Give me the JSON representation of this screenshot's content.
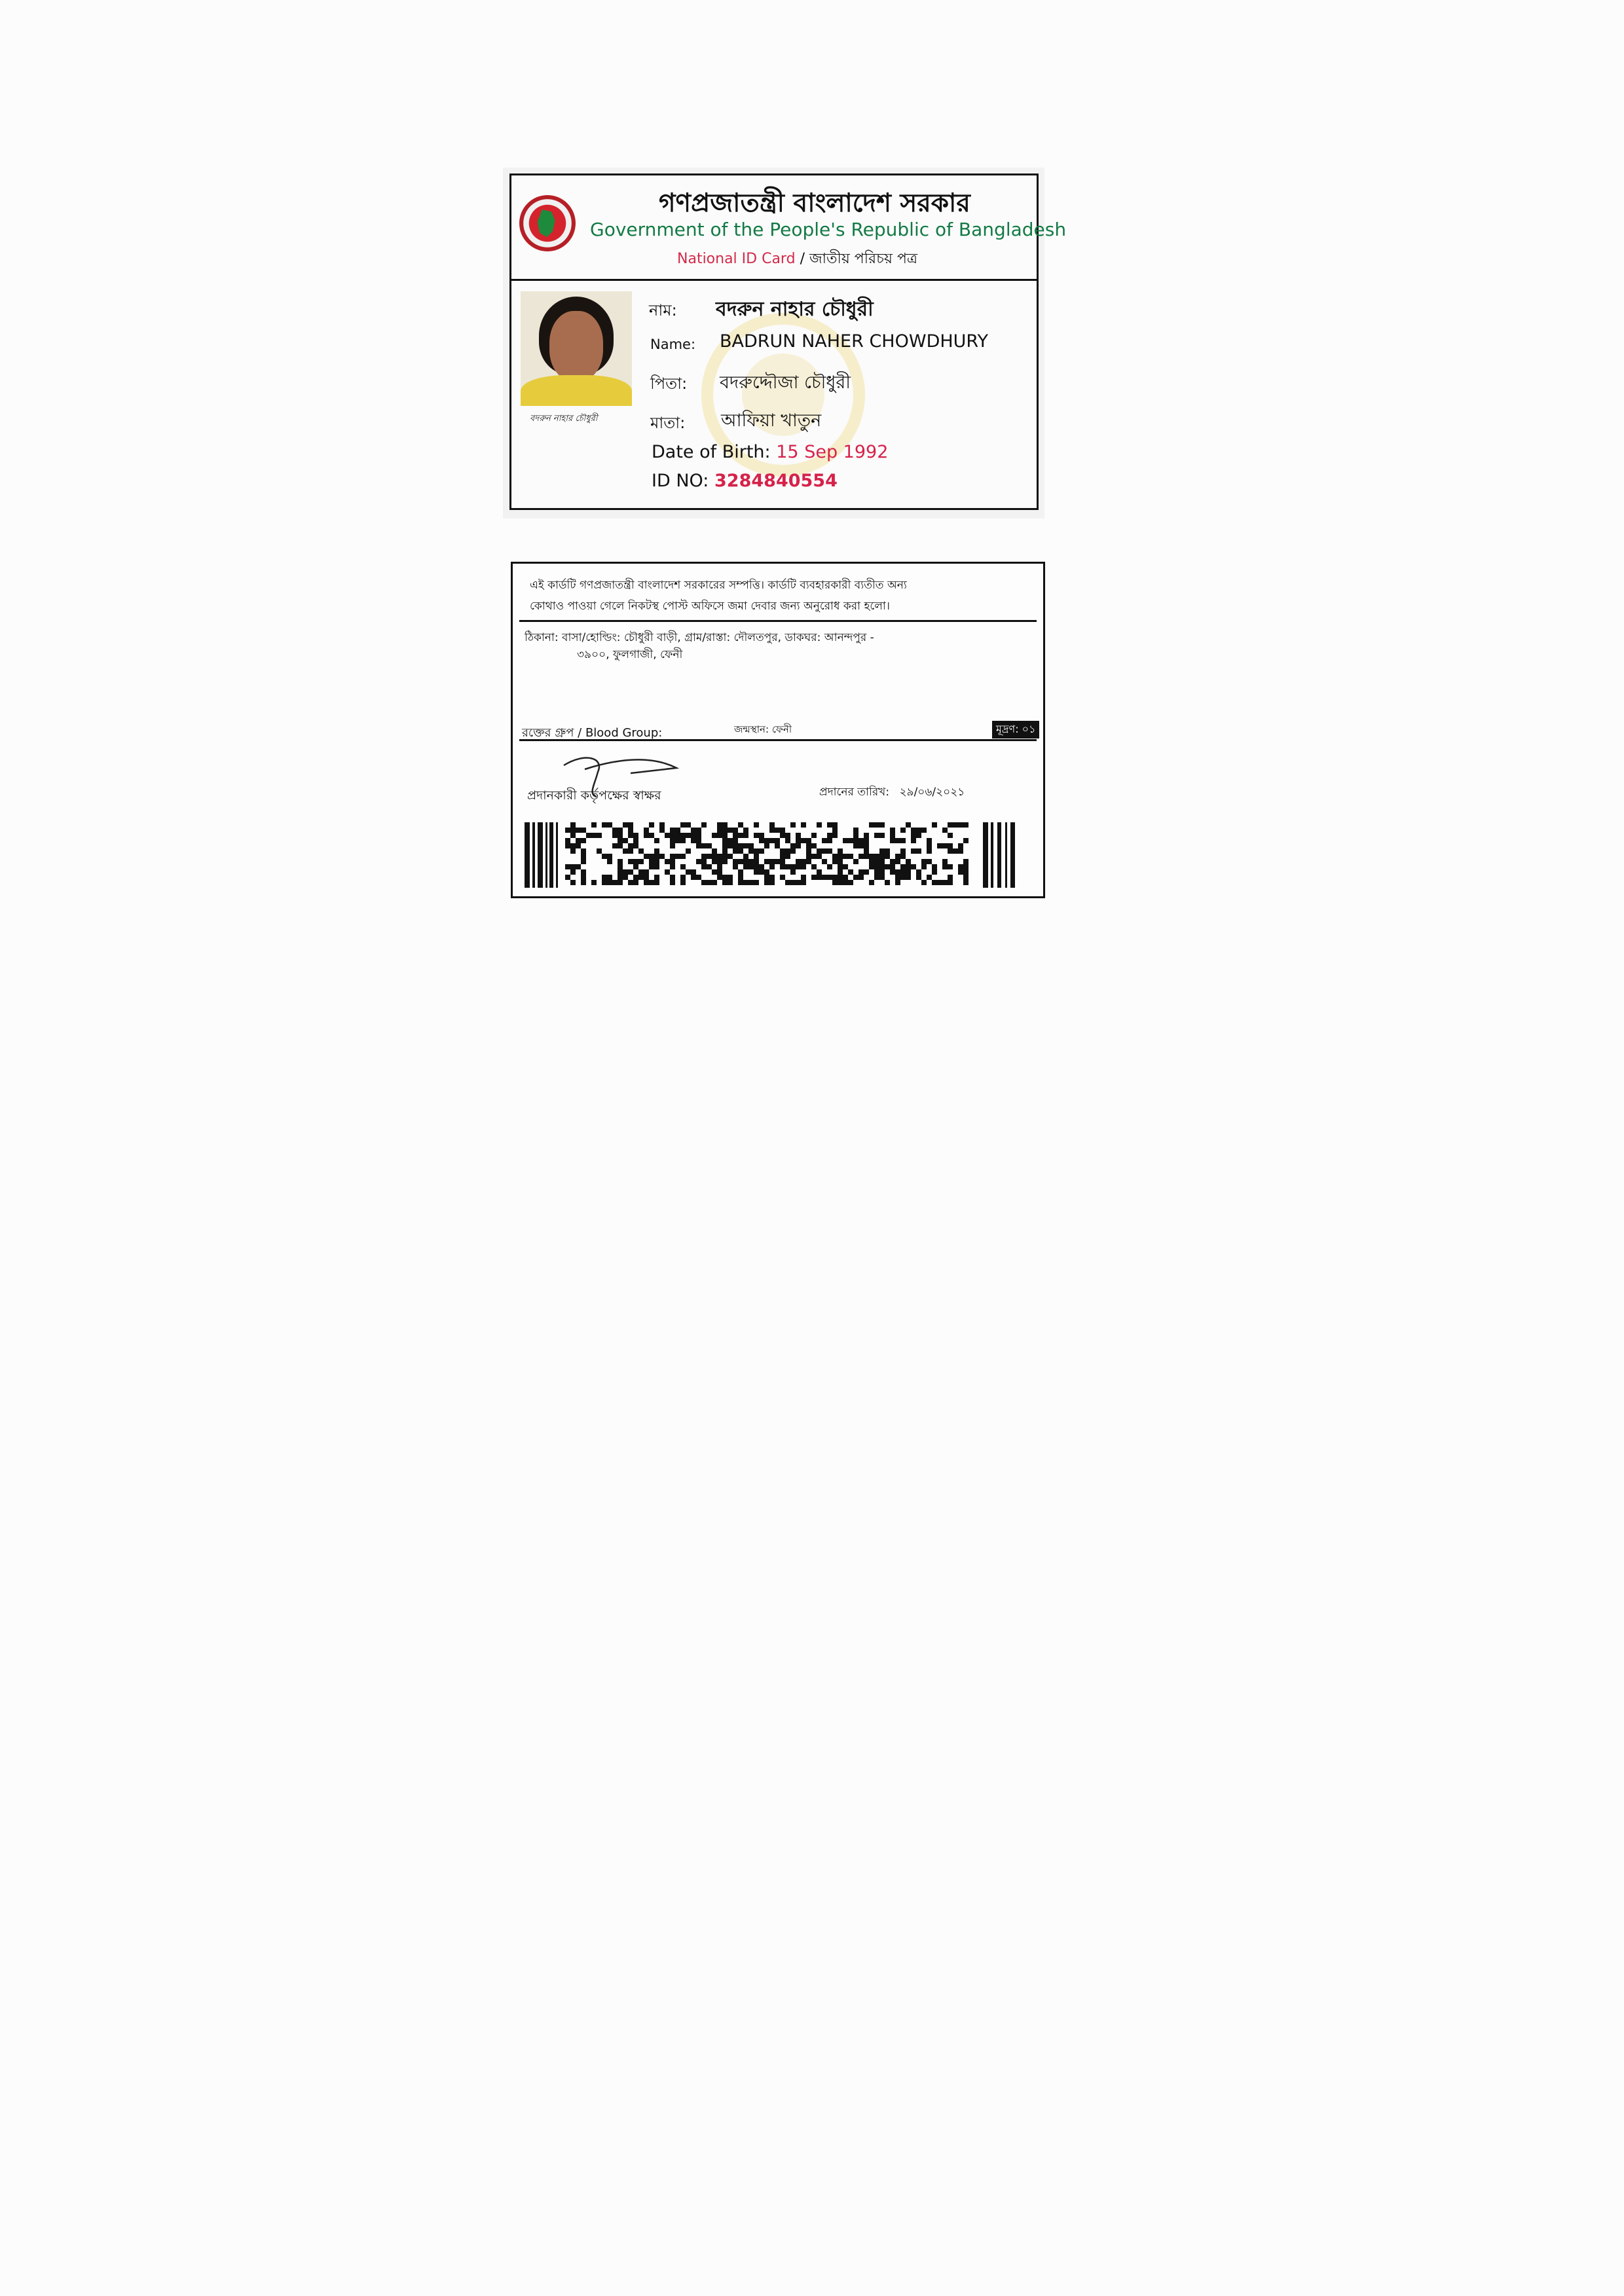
{
  "front": {
    "header_bn": "গণপ্রজাতন্ত্রী বাংলাদেশ সরকার",
    "header_en": "Government of the People's Republic of Bangladesh",
    "card_type_en": "National ID Card",
    "separator": "/",
    "card_type_bn": "জাতীয় পরিচয় পত্র",
    "photo_signature": "বদরুন নাহার চৌধুরী",
    "name_bn_label": "নাম:",
    "name_bn": "বদরুন নাহার চৌধুরী",
    "name_en_label": "Name:",
    "name_en": "BADRUN NAHER CHOWDHURY",
    "father_label": "পিতা:",
    "father": "বদরুদ্দৌজা চৌধুরী",
    "mother_label": "মাতা:",
    "mother": "আফিয়া খাতুন",
    "dob_label": "Date of Birth:",
    "dob": "15 Sep 1992",
    "id_label": "ID NO:",
    "id_no": "3284840554"
  },
  "back": {
    "notice_line1": "এই কার্ডটি গণপ্রজাতন্ত্রী বাংলাদেশ সরকারের সম্পত্তি। কার্ডটি ব্যবহারকারী ব্যতীত অন্য",
    "notice_line2": "কোথাও পাওয়া গেলে নিকটস্থ পোস্ট অফিসে জমা দেবার জন্য অনুরোধ করা হলো।",
    "address_line1": "ঠিকানা: বাসা/হোল্ডিং: চৌধুরী বাড়ী, গ্রাম/রাস্তা: দৌলতপুর, ডাকঘর: আনন্দপুর -",
    "address_line2": "৩৯০০, ফুলগাজী, ফেনী",
    "blood_group_label": "রক্তের গ্রুপ / Blood Group:",
    "birthplace": "জন্মস্থান: ফেনী",
    "code_box": "মূদ্রণ: ০১",
    "authority_sig_label": "প্রদানকারী কর্তৃপক্ষের স্বাক্ষর",
    "issue_date_label": "প্রদানের তারিখ:",
    "issue_date": "২৯/০৬/২০২১"
  },
  "colors": {
    "header_green": "#137a45",
    "accent_red": "#d6224a",
    "photo_shirt": "#e6cc3c",
    "emblem_red": "#d4232c"
  },
  "icons": [
    "bangladesh-emblem-icon",
    "barcode"
  ]
}
